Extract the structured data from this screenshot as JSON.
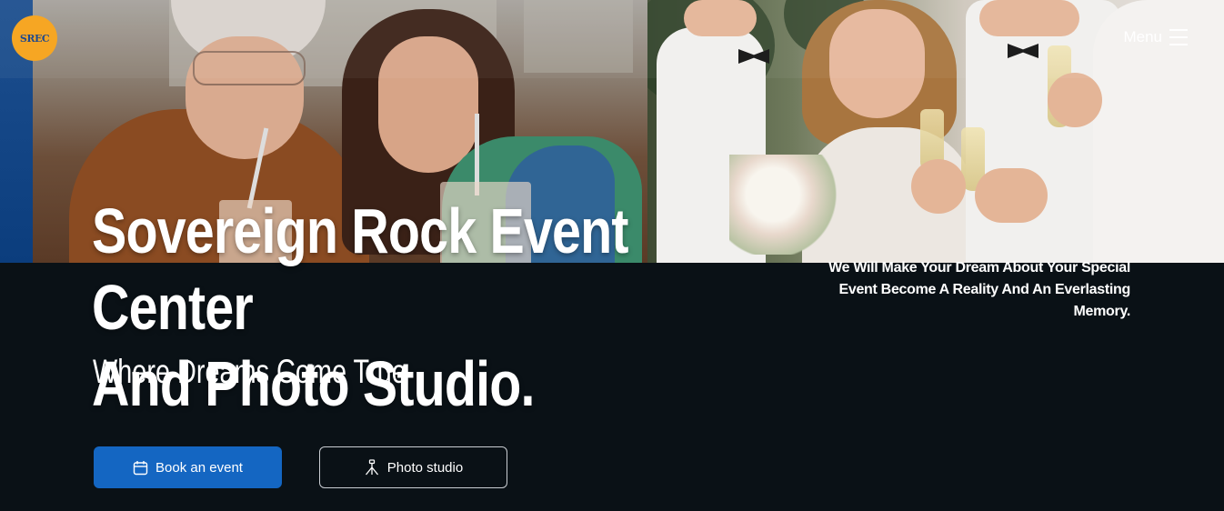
{
  "header": {
    "logo_text": "SREC",
    "menu_label": "Menu"
  },
  "hero": {
    "headline_line1": "Sovereign Rock Event Center",
    "headline_line2": "And Photo Studio.",
    "tagline": "Where Dreams Come True",
    "side_text": "We Will Make Your Dream About Your Special Event Become A Reality And An Everlasting Memory."
  },
  "buttons": {
    "book_label": "Book an event",
    "book_icon": "calendar-icon",
    "photo_label": "Photo studio",
    "photo_icon": "tripod-icon"
  },
  "colors": {
    "background": "#0a1116",
    "primary_button": "#1466c2",
    "logo_bg": "#f6a623"
  }
}
